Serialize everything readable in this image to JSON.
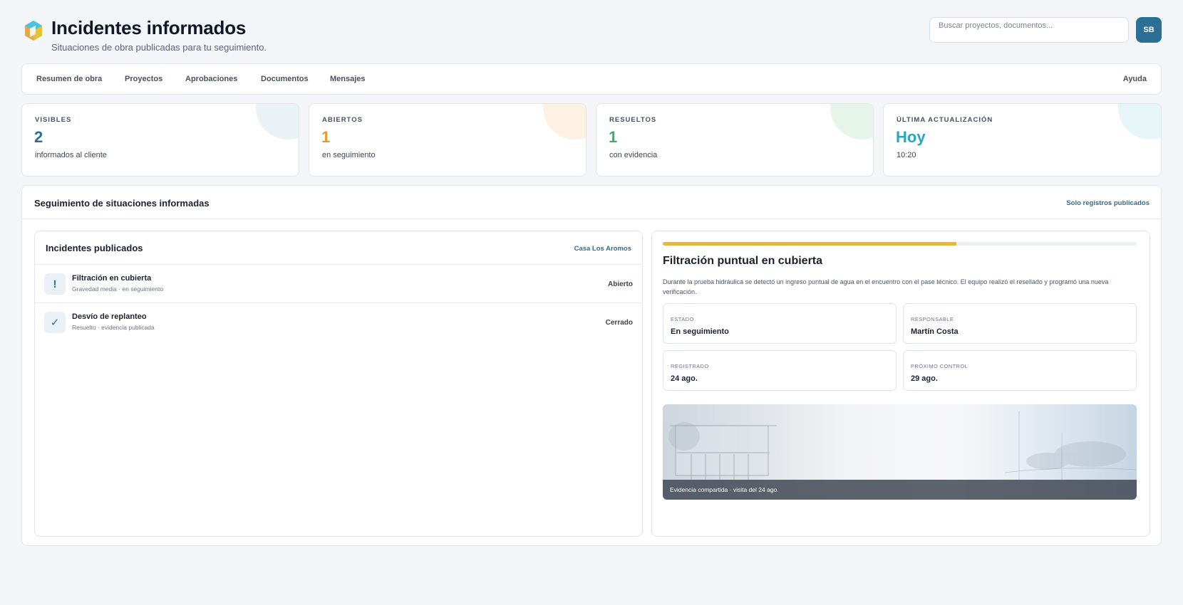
{
  "header": {
    "title": "Incidentes informados",
    "subtitle": "Situaciones de obra publicadas para tu seguimiento.",
    "search_placeholder": "Buscar proyectos, documentos...",
    "avatar_initials": "SB"
  },
  "nav": {
    "items": [
      "Resumen de obra",
      "Proyectos",
      "Aprobaciones",
      "Documentos",
      "Mensajes"
    ],
    "help": "Ayuda"
  },
  "stats": [
    {
      "label": "VISIBLES",
      "value": "2",
      "sub": "informados al cliente",
      "color": "#2c6f94",
      "bubble": "#eaf2f6"
    },
    {
      "label": "ABIERTOS",
      "value": "1",
      "sub": "en seguimiento",
      "color": "#e39a2d",
      "bubble": "#fdf1e2"
    },
    {
      "label": "RESUELTOS",
      "value": "1",
      "sub": "con evidencia",
      "color": "#3cad6a",
      "bubble": "#e6f5ea"
    },
    {
      "label": "ÚLTIMA ACTUALIZACIÓN",
      "value": "Hoy",
      "sub": "10:20",
      "color": "#29a5c4",
      "bubble": "#e5f5f8"
    }
  ],
  "panel": {
    "title": "Seguimiento de situaciones informadas",
    "link": "Solo registros publicados"
  },
  "list": {
    "title": "Incidentes publicados",
    "project": "Casa Los Aromos",
    "items": [
      {
        "icon": "!",
        "icon_name": "alert-icon",
        "title": "Filtración en cubierta",
        "sub": "Gravedad media · en seguimiento",
        "status": "Abierto"
      },
      {
        "icon": "✓",
        "icon_name": "check-icon",
        "title": "Desvío de replanteo",
        "sub": "Resuelto · evidencia publicada",
        "status": "Cerrado"
      }
    ]
  },
  "detail": {
    "progress": 0.62,
    "title": "Filtración puntual en cubierta",
    "description": "Durante la prueba hidráulica se detectó un ingreso puntual de agua en el encuentro con el pase técnico. El equipo realizó el resellado y programó una nueva verificación.",
    "fields": [
      {
        "label": "ESTADO",
        "value": "En seguimiento"
      },
      {
        "label": "RESPONSABLE",
        "value": "Martín Costa"
      },
      {
        "label": "REGISTRADO",
        "value": "24 ago."
      },
      {
        "label": "PRÓXIMO CONTROL",
        "value": "29 ago."
      }
    ],
    "photo_caption": "Evidencia compartida · visita del 24 ago."
  },
  "colors": {
    "accent": "#2c6f94",
    "progress": "#e3b64c"
  }
}
